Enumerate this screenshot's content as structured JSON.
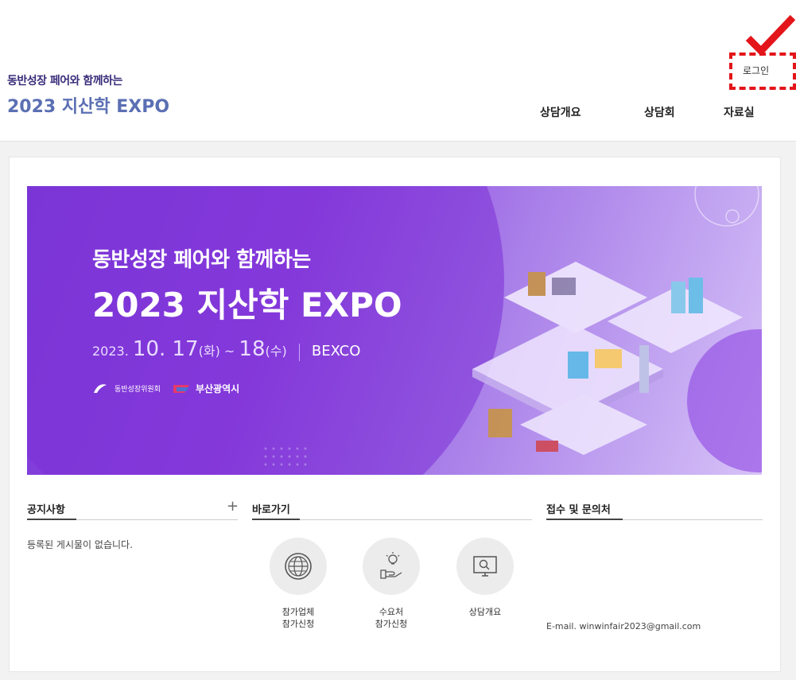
{
  "header": {
    "logo_sub": "동반성장 페어와 함께하는",
    "logo_main": "2023 지산학 EXPO",
    "login": "로그인",
    "nav": [
      "상담개요",
      "상담회",
      "자료실"
    ]
  },
  "banner": {
    "subtitle": "동반성장 페어와 함께하는",
    "title": "2023 지산학 EXPO",
    "date_prefix": "2023.",
    "date_day1": "10. 17",
    "date_day1_dow": "(화)",
    "date_tilde": " ~ ",
    "date_day2": "18",
    "date_day2_dow": "(수)",
    "venue": "BEXCO",
    "org1": "동반성장위원회",
    "org2": "부산광역시"
  },
  "notice": {
    "title": "공지사항",
    "plus": "+",
    "empty": "등록된 게시물이 없습니다."
  },
  "quick": {
    "title": "바로가기",
    "items": [
      {
        "label": "참가업체\n참가신청",
        "icon": "globe-icon"
      },
      {
        "label": "수요처\n참가신청",
        "icon": "lightbulb-hand-icon"
      },
      {
        "label": "상담개요",
        "icon": "monitor-search-icon"
      }
    ]
  },
  "contact": {
    "title": "접수 및 문의처",
    "email": "E-mail. winwinfair2023@gmail.com"
  },
  "colors": {
    "accent_purple": "#7a3bd8",
    "login_highlight": "#e3151a"
  }
}
